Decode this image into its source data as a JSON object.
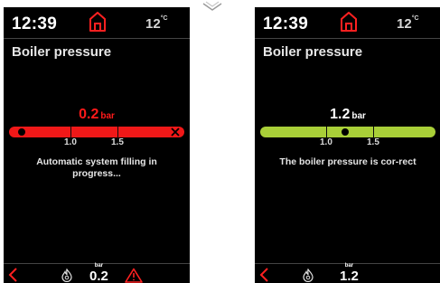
{
  "screens": [
    {
      "time": "12:39",
      "temp": "12",
      "temp_unit": "°C",
      "title": "Boiler pressure",
      "pressure_value": "0.2",
      "pressure_unit": "bar",
      "scale_labels": [
        "1.0",
        "1.5"
      ],
      "message": "Automatic system filling in progress...",
      "bottom_unit": "bar",
      "bottom_value": "0.2",
      "bar_color": "#f01818",
      "icons": [
        "home-icon",
        "back-arrow-icon",
        "flame-icon",
        "warning-icon",
        "close-x-icon"
      ]
    },
    {
      "time": "12:39",
      "temp": "12",
      "temp_unit": "°C",
      "title": "Boiler pressure",
      "pressure_value": "1.2",
      "pressure_unit": "bar",
      "scale_labels": [
        "1.0",
        "1.5"
      ],
      "message": "The boiler pressure is cor-rect",
      "bottom_unit": "bar",
      "bottom_value": "1.2",
      "bar_color": "#a9cf38",
      "icons": [
        "home-icon",
        "back-arrow-icon",
        "flame-icon"
      ]
    }
  ],
  "colors": {
    "accent_red": "#ff1a1a",
    "ok_green": "#a9cf38",
    "background": "#000000"
  }
}
